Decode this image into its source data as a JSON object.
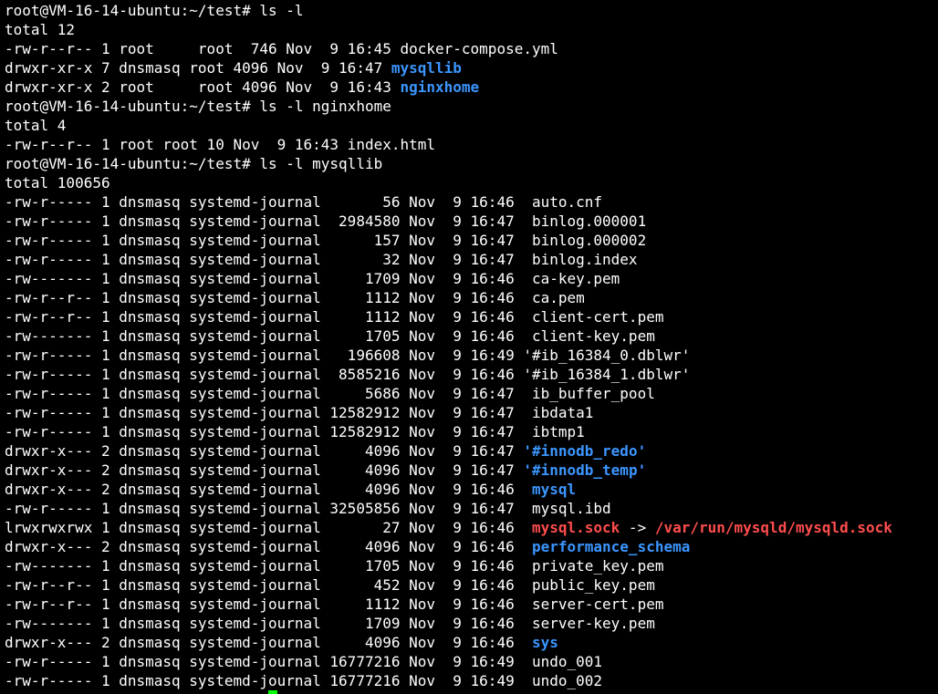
{
  "terminal": {
    "colors": {
      "background": "#000000",
      "text": "#ffffff",
      "directory": "#3b96ff",
      "symlink": "#ff4d4d",
      "cursor": "#00ff00"
    },
    "lines": [
      {
        "segments": [
          {
            "text": "root@VM-16-14-ubuntu:~/test# ls -l",
            "style": "normal"
          }
        ]
      },
      {
        "segments": [
          {
            "text": "total 12",
            "style": "normal"
          }
        ]
      },
      {
        "segments": [
          {
            "text": "-rw-r--r-- 1 root     root  746 Nov  9 16:45 docker-compose.yml",
            "style": "normal"
          }
        ]
      },
      {
        "segments": [
          {
            "text": "drwxr-xr-x 7 dnsmasq root 4096 Nov  9 16:47 ",
            "style": "normal"
          },
          {
            "text": "mysqllib",
            "style": "dir"
          }
        ]
      },
      {
        "segments": [
          {
            "text": "drwxr-xr-x 2 root     root 4096 Nov  9 16:43 ",
            "style": "normal"
          },
          {
            "text": "nginxhome",
            "style": "dir"
          }
        ]
      },
      {
        "segments": [
          {
            "text": "root@VM-16-14-ubuntu:~/test# ls -l nginxhome",
            "style": "normal"
          }
        ]
      },
      {
        "segments": [
          {
            "text": "total 4",
            "style": "normal"
          }
        ]
      },
      {
        "segments": [
          {
            "text": "-rw-r--r-- 1 root root 10 Nov  9 16:43 index.html",
            "style": "normal"
          }
        ]
      },
      {
        "segments": [
          {
            "text": "root@VM-16-14-ubuntu:~/test# ls -l mysqllib",
            "style": "normal"
          }
        ]
      },
      {
        "segments": [
          {
            "text": "total 100656",
            "style": "normal"
          }
        ]
      },
      {
        "segments": [
          {
            "text": "-rw-r----- 1 dnsmasq systemd-journal       56 Nov  9 16:46  auto.cnf",
            "style": "normal"
          }
        ]
      },
      {
        "segments": [
          {
            "text": "-rw-r----- 1 dnsmasq systemd-journal  2984580 Nov  9 16:47  binlog.000001",
            "style": "normal"
          }
        ]
      },
      {
        "segments": [
          {
            "text": "-rw-r----- 1 dnsmasq systemd-journal      157 Nov  9 16:47  binlog.000002",
            "style": "normal"
          }
        ]
      },
      {
        "segments": [
          {
            "text": "-rw-r----- 1 dnsmasq systemd-journal       32 Nov  9 16:47  binlog.index",
            "style": "normal"
          }
        ]
      },
      {
        "segments": [
          {
            "text": "-rw------- 1 dnsmasq systemd-journal     1709 Nov  9 16:46  ca-key.pem",
            "style": "normal"
          }
        ]
      },
      {
        "segments": [
          {
            "text": "-rw-r--r-- 1 dnsmasq systemd-journal     1112 Nov  9 16:46  ca.pem",
            "style": "normal"
          }
        ]
      },
      {
        "segments": [
          {
            "text": "-rw-r--r-- 1 dnsmasq systemd-journal     1112 Nov  9 16:46  client-cert.pem",
            "style": "normal"
          }
        ]
      },
      {
        "segments": [
          {
            "text": "-rw------- 1 dnsmasq systemd-journal     1705 Nov  9 16:46  client-key.pem",
            "style": "normal"
          }
        ]
      },
      {
        "segments": [
          {
            "text": "-rw-r----- 1 dnsmasq systemd-journal   196608 Nov  9 16:49 '#ib_16384_0.dblwr'",
            "style": "normal"
          }
        ]
      },
      {
        "segments": [
          {
            "text": "-rw-r----- 1 dnsmasq systemd-journal  8585216 Nov  9 16:46 '#ib_16384_1.dblwr'",
            "style": "normal"
          }
        ]
      },
      {
        "segments": [
          {
            "text": "-rw-r----- 1 dnsmasq systemd-journal     5686 Nov  9 16:47  ib_buffer_pool",
            "style": "normal"
          }
        ]
      },
      {
        "segments": [
          {
            "text": "-rw-r----- 1 dnsmasq systemd-journal 12582912 Nov  9 16:47  ibdata1",
            "style": "normal"
          }
        ]
      },
      {
        "segments": [
          {
            "text": "-rw-r----- 1 dnsmasq systemd-journal 12582912 Nov  9 16:47  ibtmp1",
            "style": "normal"
          }
        ]
      },
      {
        "segments": [
          {
            "text": "drwxr-x--- 2 dnsmasq systemd-journal     4096 Nov  9 16:47 ",
            "style": "normal"
          },
          {
            "text": "'#innodb_redo'",
            "style": "dir"
          }
        ]
      },
      {
        "segments": [
          {
            "text": "drwxr-x--- 2 dnsmasq systemd-journal     4096 Nov  9 16:47 ",
            "style": "normal"
          },
          {
            "text": "'#innodb_temp'",
            "style": "dir"
          }
        ]
      },
      {
        "segments": [
          {
            "text": "drwxr-x--- 2 dnsmasq systemd-journal     4096 Nov  9 16:46  ",
            "style": "normal"
          },
          {
            "text": "mysql",
            "style": "dir"
          }
        ]
      },
      {
        "segments": [
          {
            "text": "-rw-r----- 1 dnsmasq systemd-journal 32505856 Nov  9 16:47  mysql.ibd",
            "style": "normal"
          }
        ]
      },
      {
        "segments": [
          {
            "text": "lrwxrwxrwx 1 dnsmasq systemd-journal       27 Nov  9 16:46  ",
            "style": "normal"
          },
          {
            "text": "mysql.sock",
            "style": "link"
          },
          {
            "text": " -> ",
            "style": "normal"
          },
          {
            "text": "/var/run/mysqld/mysqld.sock",
            "style": "link"
          }
        ]
      },
      {
        "segments": [
          {
            "text": "drwxr-x--- 2 dnsmasq systemd-journal     4096 Nov  9 16:46  ",
            "style": "normal"
          },
          {
            "text": "performance_schema",
            "style": "dir"
          }
        ]
      },
      {
        "segments": [
          {
            "text": "-rw------- 1 dnsmasq systemd-journal     1705 Nov  9 16:46  private_key.pem",
            "style": "normal"
          }
        ]
      },
      {
        "segments": [
          {
            "text": "-rw-r--r-- 1 dnsmasq systemd-journal      452 Nov  9 16:46  public_key.pem",
            "style": "normal"
          }
        ]
      },
      {
        "segments": [
          {
            "text": "-rw-r--r-- 1 dnsmasq systemd-journal     1112 Nov  9 16:46  server-cert.pem",
            "style": "normal"
          }
        ]
      },
      {
        "segments": [
          {
            "text": "-rw------- 1 dnsmasq systemd-journal     1709 Nov  9 16:46  server-key.pem",
            "style": "normal"
          }
        ]
      },
      {
        "segments": [
          {
            "text": "drwxr-x--- 2 dnsmasq systemd-journal     4096 Nov  9 16:46  ",
            "style": "normal"
          },
          {
            "text": "sys",
            "style": "dir"
          }
        ]
      },
      {
        "segments": [
          {
            "text": "-rw-r----- 1 dnsmasq systemd-journal 16777216 Nov  9 16:49  undo_001",
            "style": "normal"
          }
        ]
      },
      {
        "segments": [
          {
            "text": "-rw-r----- 1 dnsmasq systemd-journal 16777216 Nov  9 16:49  undo_002",
            "style": "normal"
          }
        ]
      }
    ]
  }
}
